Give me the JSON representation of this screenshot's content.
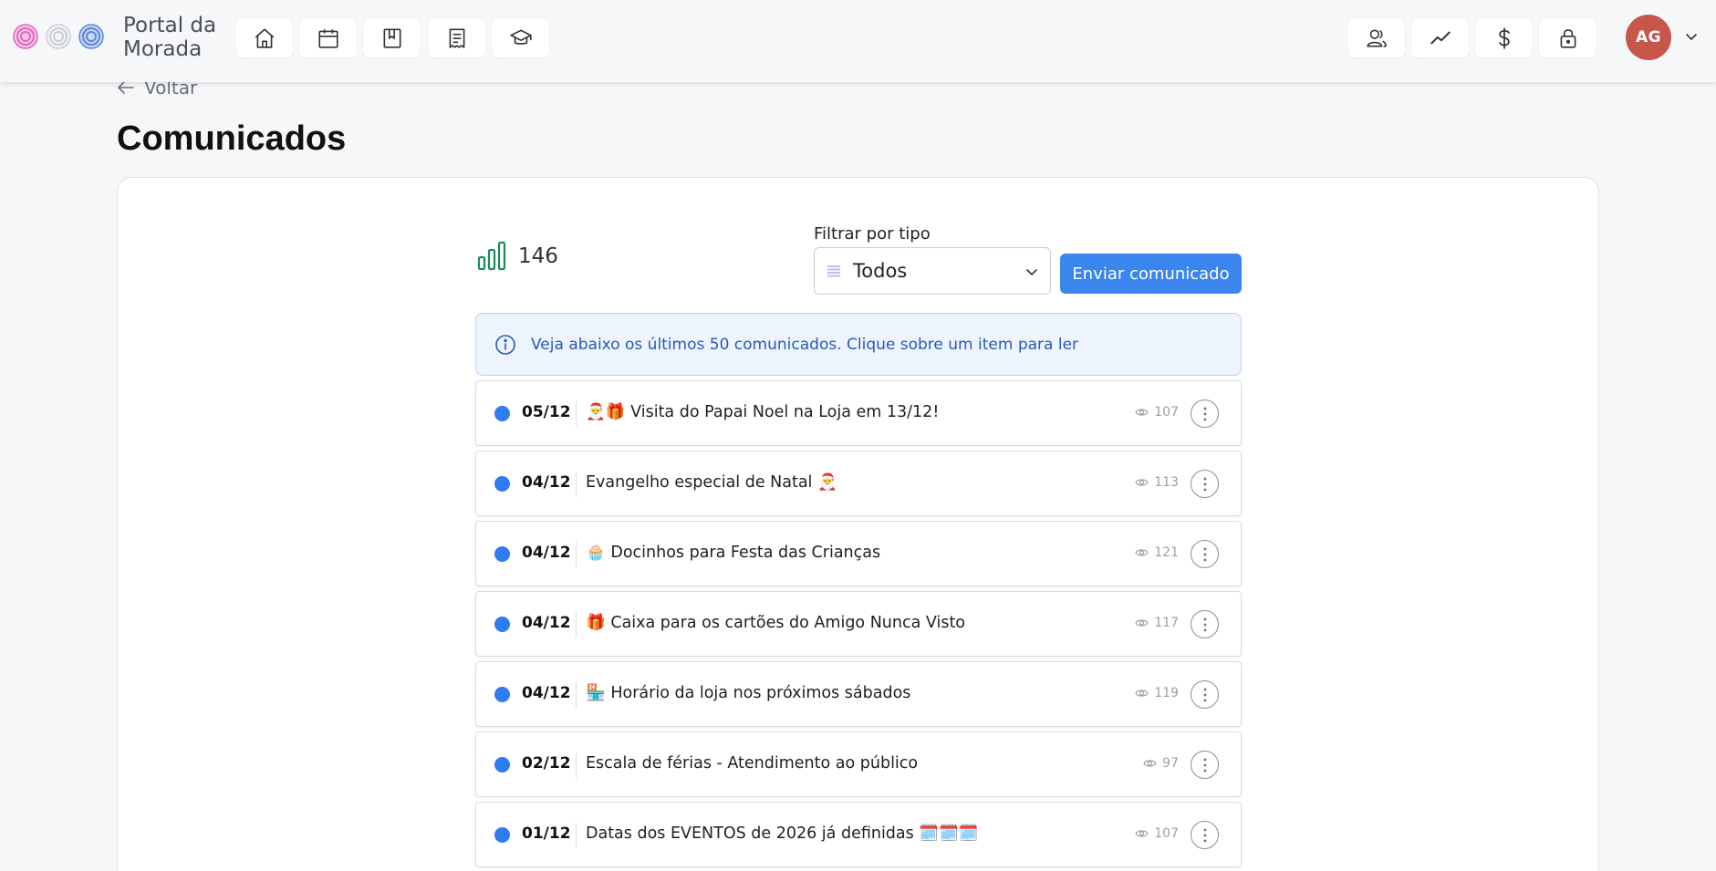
{
  "header": {
    "brand_line1": "Portal da",
    "brand_line2": "Morada",
    "logo_icons": [
      "rose-pink-icon",
      "rose-white-icon",
      "rose-blue-icon"
    ],
    "nav_left": [
      "home-icon",
      "calendar-icon",
      "bookmark-icon",
      "receipt-icon",
      "graduation-cap-icon"
    ],
    "nav_right": [
      "users-icon",
      "chart-line-icon",
      "dollar-icon",
      "lock-icon"
    ],
    "avatar_initials": "AG",
    "avatar_color": "#c8574b"
  },
  "page": {
    "back_label": "Voltar",
    "title": "Comunicados"
  },
  "stats": {
    "count": "146",
    "icon": "bar-chart-icon"
  },
  "filter": {
    "label": "Filtrar por tipo",
    "selected": "Todos"
  },
  "actions": {
    "send_label": "Enviar comunicado",
    "accent": "#3a86ee"
  },
  "info": {
    "text": "Veja abaixo os últimos 50 comunicados. Clique sobre um item para ler"
  },
  "announcements": [
    {
      "date": "05/12",
      "title": "🎅🎁 Visita do Papai Noel na Loja em 13/12!",
      "views": "107"
    },
    {
      "date": "04/12",
      "title": "Evangelho especial de Natal 🎅",
      "views": "113"
    },
    {
      "date": "04/12",
      "title": "🧁 Docinhos para Festa das Crianças",
      "views": "121"
    },
    {
      "date": "04/12",
      "title": "🎁 Caixa para os cartões do Amigo Nunca Visto",
      "views": "117"
    },
    {
      "date": "04/12",
      "title": "🏪 Horário da loja nos próximos sábados",
      "views": "119"
    },
    {
      "date": "02/12",
      "title": "Escala de férias - Atendimento ao público",
      "views": "97"
    },
    {
      "date": "01/12",
      "title": "Datas dos EVENTOS de 2026 já definidas 🗓️🗓️🗓️",
      "views": "107"
    }
  ]
}
